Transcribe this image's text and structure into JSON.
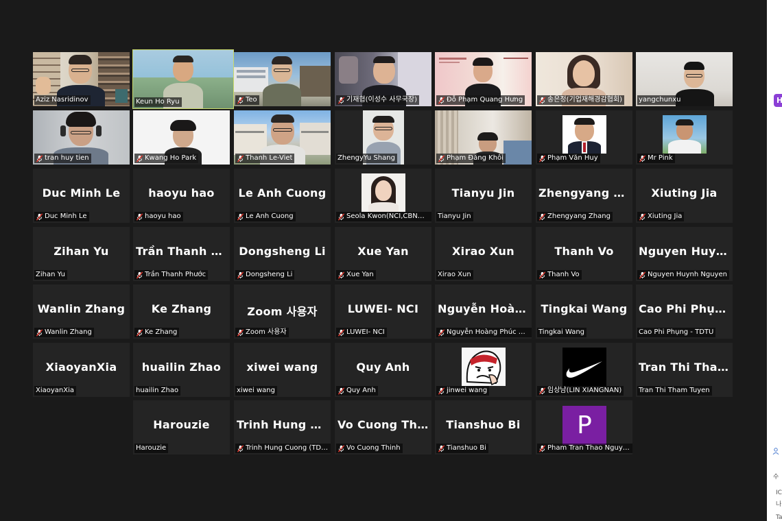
{
  "colors": {
    "background": "#1a1a1a",
    "tile": "#242424",
    "active_speaker": "#c9d96a",
    "muted_mic": "#e0382e",
    "avatar_purple": "#7a1fa2"
  },
  "participants": [
    {
      "big": "",
      "label": "Aziz Nasridinov",
      "muted": false
    },
    {
      "big": "",
      "label": "Keun Ho Ryu",
      "muted": false
    },
    {
      "big": "",
      "label": "Teo",
      "muted": true
    },
    {
      "big": "",
      "label": "기재협(이성수 사무국장)",
      "muted": true
    },
    {
      "big": "",
      "label": "Đỗ Phạm Quang Hưng",
      "muted": true
    },
    {
      "big": "",
      "label": "송은정(기업재해경감협회)",
      "muted": true
    },
    {
      "big": "",
      "label": "yangchunxu",
      "muted": false
    },
    {
      "big": "",
      "label": "tran huy tien",
      "muted": true
    },
    {
      "big": "",
      "label": "Kwang Ho Park",
      "muted": true
    },
    {
      "big": "",
      "label": "Thanh Le-Viet",
      "muted": true
    },
    {
      "big": "",
      "label": "ZhengyYu Shang",
      "muted": false
    },
    {
      "big": "",
      "label": "Phạm Đăng Khôi",
      "muted": true
    },
    {
      "big": "",
      "label": "Phạm Văn Huy",
      "muted": true
    },
    {
      "big": "",
      "label": "Mr Pink",
      "muted": true
    },
    {
      "big": "Duc Minh Le",
      "label": "Duc Minh Le",
      "muted": true
    },
    {
      "big": "haoyu hao",
      "label": "haoyu hao",
      "muted": true
    },
    {
      "big": "Le Anh Cuong",
      "label": "Le Anh Cuong",
      "muted": true
    },
    {
      "big": "",
      "label": "Seola Kwon(NCI,CBNU,Ko...",
      "muted": true
    },
    {
      "big": "Tianyu Jin",
      "label": "Tianyu Jin",
      "muted": false
    },
    {
      "big": "Zhengyang  Zha...",
      "label": "Zhengyang Zhang",
      "muted": true
    },
    {
      "big": "Xiuting Jia",
      "label": "Xiuting Jia",
      "muted": true
    },
    {
      "big": "Zihan Yu",
      "label": "Zihan Yu",
      "muted": false
    },
    {
      "big": "Trần  Thanh  Phư...",
      "label": "Trần Thanh Phước",
      "muted": true
    },
    {
      "big": "Dongsheng Li",
      "label": "Dongsheng Li",
      "muted": true
    },
    {
      "big": "Xue Yan",
      "label": "Xue Yan",
      "muted": true
    },
    {
      "big": "Xirao Xun",
      "label": "Xirao Xun",
      "muted": false
    },
    {
      "big": "Thanh Vo",
      "label": "Thanh Vo",
      "muted": true
    },
    {
      "big": "Nguyen  Huynh...",
      "label": "Nguyen Huynh Nguyen",
      "muted": true
    },
    {
      "big": "Wanlin Zhang",
      "label": "Wanlin Zhang",
      "muted": true
    },
    {
      "big": "Ke Zhang",
      "label": "Ke Zhang",
      "muted": true
    },
    {
      "big": "Zoom  사용자",
      "label": "Zoom 사용자",
      "muted": true
    },
    {
      "big": "LUWEI- NCI",
      "label": "LUWEI- NCI",
      "muted": true
    },
    {
      "big": "Nguyễn  Hoàng...",
      "label": "Nguyễn Hoàng Phúc Kha...",
      "muted": true
    },
    {
      "big": "Tingkai Wang",
      "label": "Tingkai Wang",
      "muted": false
    },
    {
      "big": "Cao  Phi  Phụng...",
      "label": "Cao Phi Phụng - TDTU",
      "muted": false
    },
    {
      "big": "XiaoyanXia",
      "label": "XiaoyanXia",
      "muted": false
    },
    {
      "big": "huailin Zhao",
      "label": "huailin Zhao",
      "muted": false
    },
    {
      "big": "xiwei wang",
      "label": "xiwei wang",
      "muted": false
    },
    {
      "big": "Quy Anh",
      "label": "Quy Anh",
      "muted": true
    },
    {
      "big": "",
      "label": "jinwei wang",
      "muted": true
    },
    {
      "big": "",
      "label": "임상남(LIN XIANGNAN)",
      "muted": true
    },
    {
      "big": "Tran  Thi  Tham  T...",
      "label": "Tran Thi Tham Tuyen",
      "muted": false
    },
    {
      "big": "Harouzie",
      "label": "Harouzie",
      "muted": false
    },
    {
      "big": "Trinh  Hung  Cuo...",
      "label": "Trinh Hung Cuong (TDTU)",
      "muted": true
    },
    {
      "big": "Vo Cuong Thinh",
      "label": "Vo Cuong Thinh",
      "muted": true
    },
    {
      "big": "Tianshuo Bi",
      "label": "Tianshuo Bi",
      "muted": true
    },
    {
      "big": "",
      "label": "Pham Tran Thao Nguyen",
      "muted": true
    }
  ],
  "avatar_letter": "P",
  "right_panel": {
    "tab_letter": "H",
    "text_1": "수",
    "text_2": "IC",
    "text_3": "나",
    "text_4": "Ta"
  }
}
